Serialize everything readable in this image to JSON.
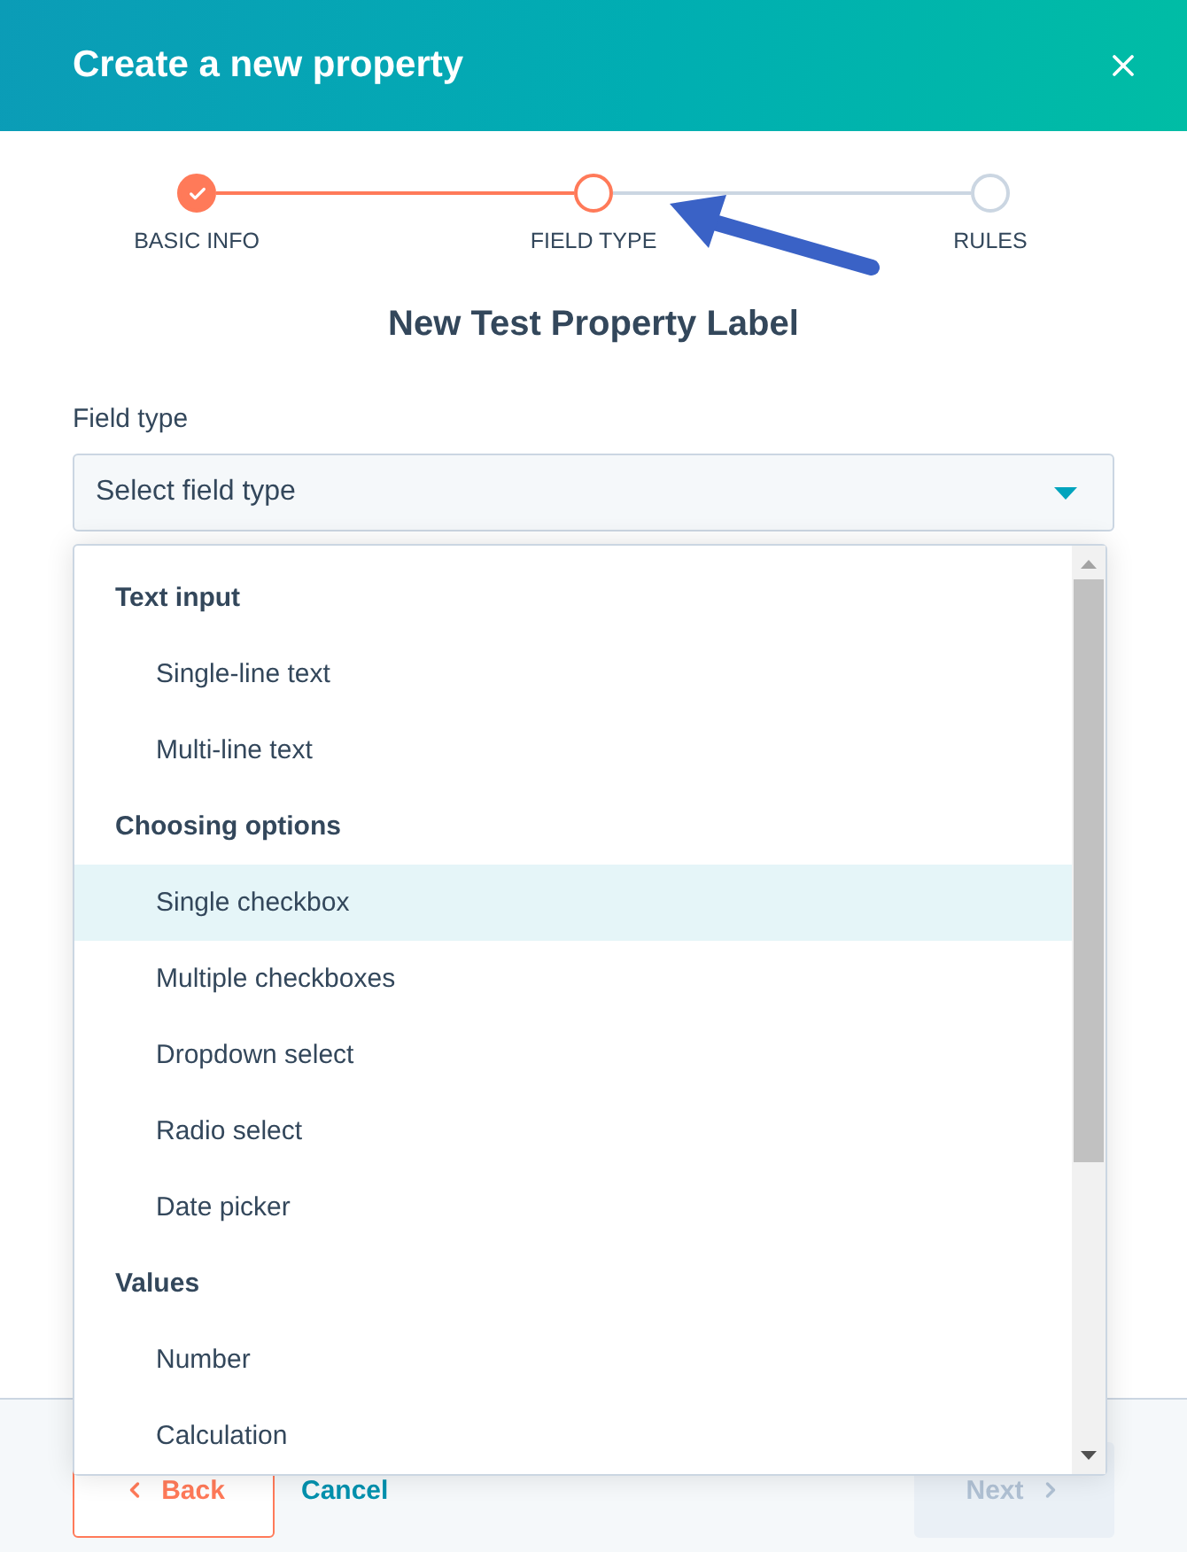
{
  "header": {
    "title": "Create a new property"
  },
  "steps": [
    {
      "label": "BASIC INFO",
      "completed": true,
      "selected": false
    },
    {
      "label": "FIELD TYPE",
      "completed": false,
      "selected": true
    },
    {
      "label": "RULES",
      "completed": false,
      "selected": false
    }
  ],
  "heading": "New Test Property Label",
  "field": {
    "label": "Field type",
    "placeholder": "Select field type",
    "expanded": true
  },
  "dropdown": {
    "groups": [
      {
        "label": "Text input",
        "options": [
          {
            "label": "Single-line text",
            "selected": false
          },
          {
            "label": "Multi-line text",
            "selected": false
          }
        ]
      },
      {
        "label": "Choosing options",
        "options": [
          {
            "label": "Single checkbox",
            "selected": true
          },
          {
            "label": "Multiple checkboxes",
            "selected": false
          },
          {
            "label": "Dropdown select",
            "selected": false
          },
          {
            "label": "Radio select",
            "selected": false
          },
          {
            "label": "Date picker",
            "selected": false
          }
        ]
      },
      {
        "label": "Values",
        "options": [
          {
            "label": "Number",
            "selected": false
          },
          {
            "label": "Calculation",
            "selected": false
          }
        ]
      }
    ]
  },
  "footer": {
    "back": "Back",
    "cancel": "Cancel",
    "next": {
      "label": "Next",
      "disabled": true
    }
  }
}
